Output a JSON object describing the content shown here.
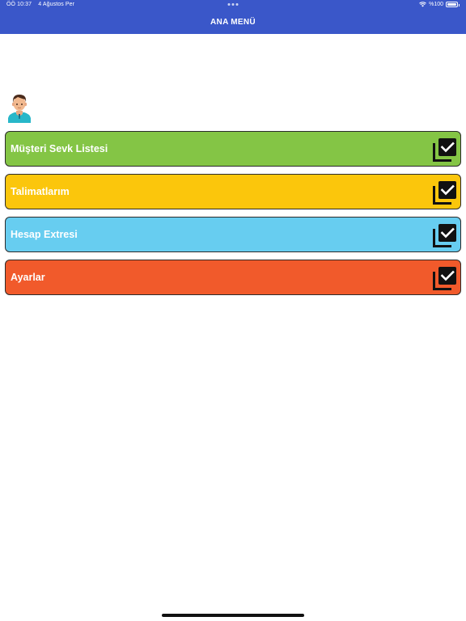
{
  "status_bar": {
    "time": "ÖÖ 10:37",
    "date": "4 Ağustos Per",
    "battery": "%100"
  },
  "header": {
    "title": "ANA MENÜ"
  },
  "icons": {
    "avatar": "user-avatar-icon",
    "menu_item": "checkbox-stack-icon"
  },
  "menu": {
    "items": [
      {
        "label": "Müşteri Sevk Listesi",
        "color": "#84c545"
      },
      {
        "label": "Talimatlarım",
        "color": "#fbc60c"
      },
      {
        "label": "Hesap Extresi",
        "color": "#67cdf0"
      },
      {
        "label": "Ayarlar",
        "color": "#f15a2b"
      }
    ]
  },
  "colors": {
    "header": "#3a57c9",
    "background": "#ffffff"
  }
}
